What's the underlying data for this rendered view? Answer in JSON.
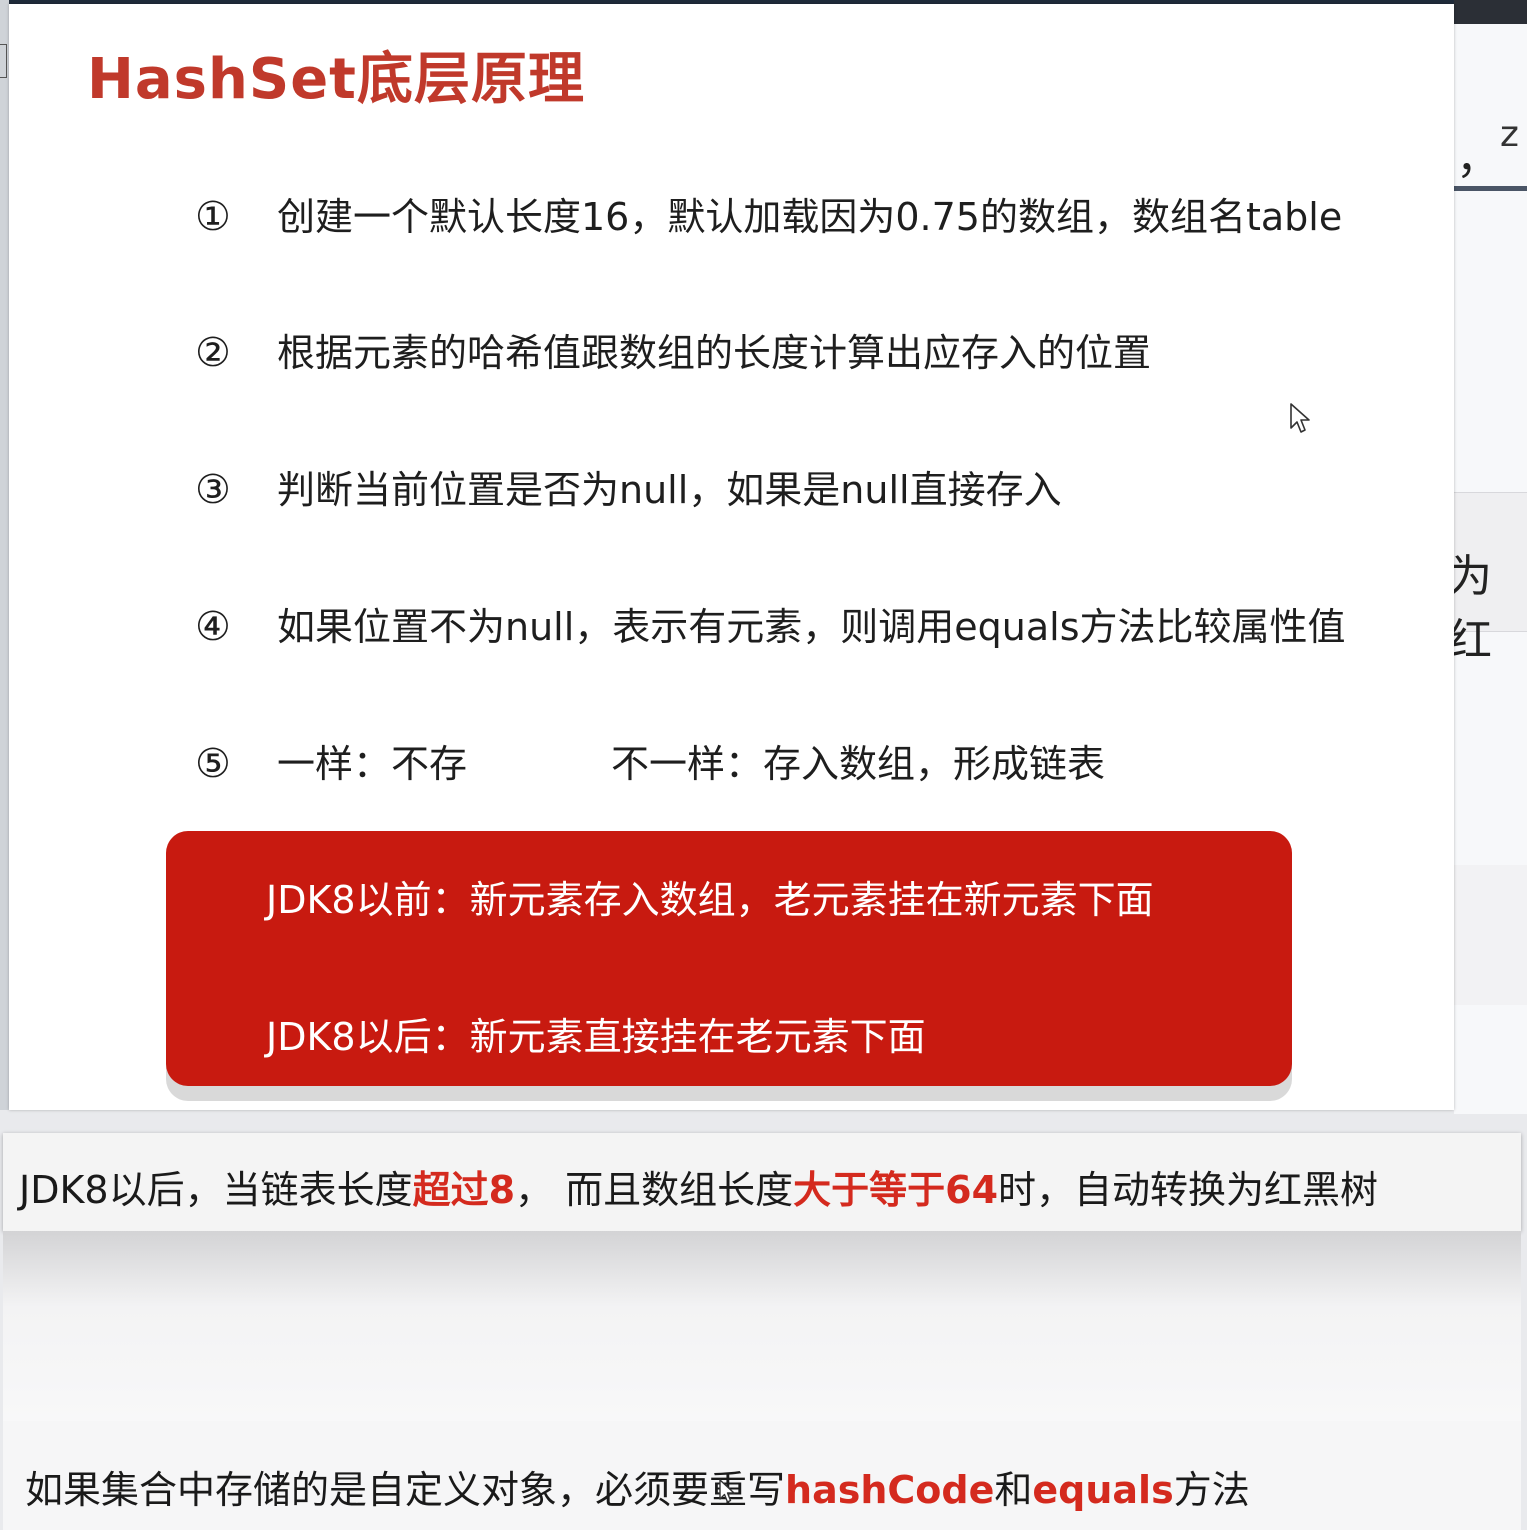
{
  "slide": {
    "title": "HashSet底层原理",
    "steps": [
      {
        "num": "①",
        "text": "创建一个默认长度16，默认加载因为0.75的数组，数组名table"
      },
      {
        "num": "②",
        "text": "根据元素的哈希值跟数组的长度计算出应存入的位置"
      },
      {
        "num": "③",
        "text": "判断当前位置是否为null，如果是null直接存入"
      },
      {
        "num": "④",
        "text": "如果位置不为null，表示有元素，则调用equals方法比较属性值"
      },
      {
        "num": "⑤",
        "text_a": "一样：不存",
        "text_b": "不一样：存入数组，形成链表"
      }
    ],
    "red_box": {
      "line1": "JDK8以前：新元素存入数组，老元素挂在新元素下面",
      "line2": "JDK8以后：新元素直接挂在老元素下面"
    }
  },
  "background_fragments": {
    "frag1": "，",
    "frag2": "z",
    "frag3": "为红"
  },
  "caption1": {
    "part1": "JDK8以后，当链表长度",
    "hl1": "超过8",
    "part2": "，  而且数组长度",
    "hl2": "大于等于64",
    "part3": "时，自动转换为红黑树"
  },
  "caption2": {
    "part1": "如果集合中存储的是自定义对象，必须要重写",
    "hl1": "hashCode",
    "part2": "和",
    "hl2": "equals",
    "part3": "方法"
  },
  "colors": {
    "title": "#c0392b",
    "red_box": "#c81a10",
    "highlight": "#d42a1e"
  }
}
